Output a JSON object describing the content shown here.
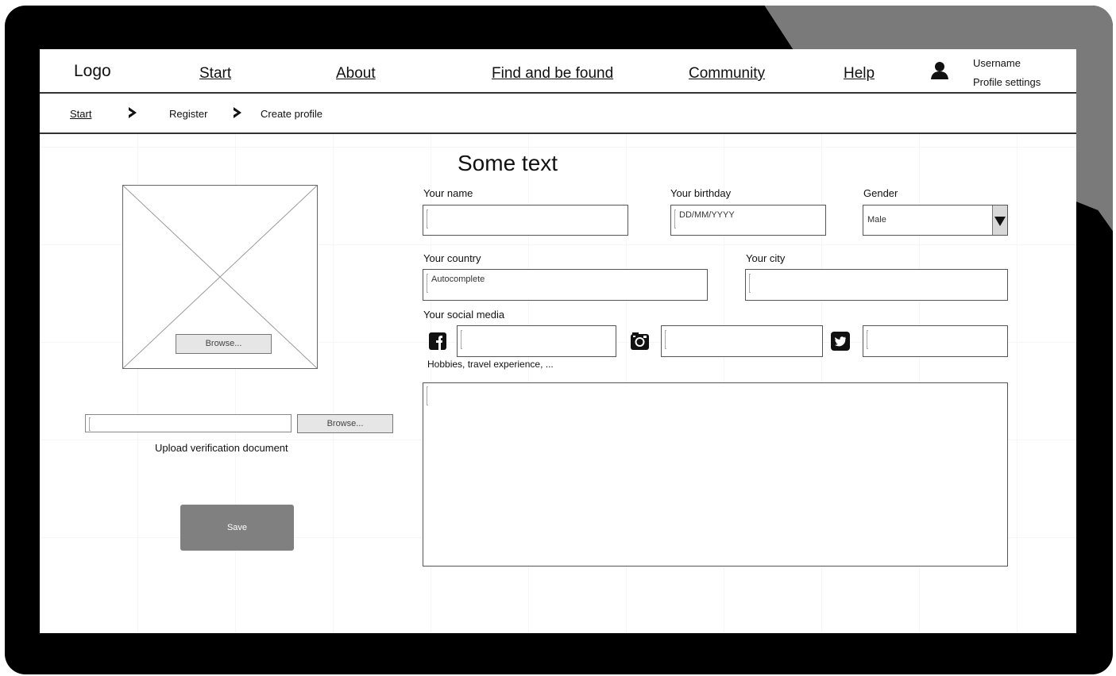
{
  "header": {
    "logo": "Logo",
    "nav": [
      "Start",
      "About",
      "Find and be found",
      "Community",
      "Help"
    ],
    "username": "Username",
    "profile_settings": "Profile settings"
  },
  "breadcrumb": [
    "Start",
    "Register",
    "Create profile"
  ],
  "left_panel": {
    "browse_photo": "Browse...",
    "browse_document": "Browse...",
    "upload_label": "Upload verification document",
    "save": "Save"
  },
  "form": {
    "heading": "Some text",
    "name_label": "Your name",
    "birthday_label": "Your birthday",
    "birthday_placeholder": "DD/MM/YYYY",
    "gender_label": "Gender",
    "gender_value": "Male",
    "country_label": "Your country",
    "country_placeholder": "Autocomplete",
    "city_label": "Your city",
    "social_label": "Your social media",
    "hobbies_label": "Hobbies, travel experience, ..."
  },
  "icons": [
    "user-icon",
    "chevron-right-icon",
    "facebook-icon",
    "instagram-icon",
    "twitter-icon",
    "dropdown-arrow-icon"
  ]
}
